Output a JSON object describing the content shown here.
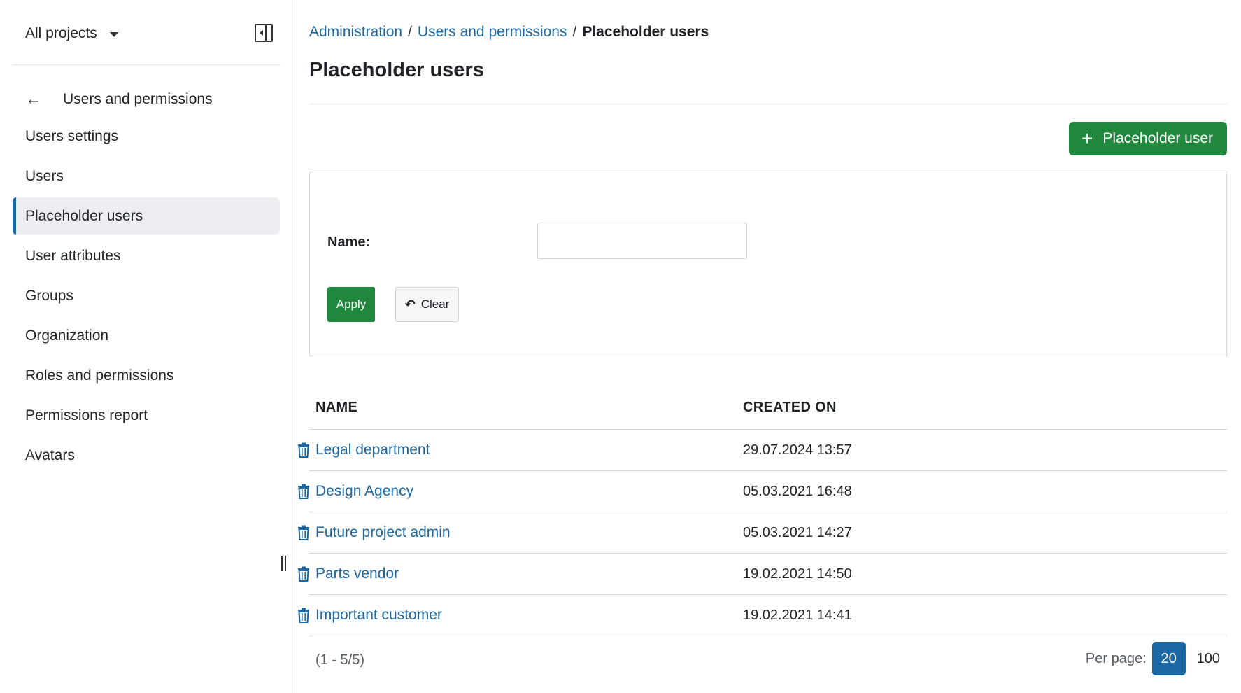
{
  "sidebar": {
    "project_selector": "All projects",
    "back_label": "Users and permissions",
    "items": [
      {
        "label": "Users settings",
        "active": false
      },
      {
        "label": "Users",
        "active": false
      },
      {
        "label": "Placeholder users",
        "active": true
      },
      {
        "label": "User attributes",
        "active": false
      },
      {
        "label": "Groups",
        "active": false
      },
      {
        "label": "Organization",
        "active": false
      },
      {
        "label": "Roles and permissions",
        "active": false
      },
      {
        "label": "Permissions report",
        "active": false
      },
      {
        "label": "Avatars",
        "active": false
      }
    ]
  },
  "breadcrumb": {
    "items": [
      "Administration",
      "Users and permissions"
    ],
    "separator": "/",
    "current": "Placeholder users"
  },
  "page": {
    "title": "Placeholder users",
    "add_button_label": "Placeholder user"
  },
  "filter": {
    "name_label": "Name:",
    "name_value": "",
    "apply_label": "Apply",
    "clear_label": "Clear"
  },
  "table": {
    "headers": {
      "name": "NAME",
      "created_on": "CREATED ON"
    },
    "rows": [
      {
        "name": "Legal department",
        "created_on": "29.07.2024 13:57"
      },
      {
        "name": "Design Agency",
        "created_on": "05.03.2021 16:48"
      },
      {
        "name": "Future project admin",
        "created_on": "05.03.2021 14:27"
      },
      {
        "name": "Parts vendor",
        "created_on": "19.02.2021 14:50"
      },
      {
        "name": "Important customer",
        "created_on": "19.02.2021 14:41"
      }
    ]
  },
  "pagination": {
    "info": "(1 - 5/5)",
    "per_page_label": "Per page:",
    "options": [
      "20",
      "100"
    ],
    "selected": "20"
  },
  "colors": {
    "accent": "#1a67a3",
    "primary_button": "#1f883d"
  }
}
